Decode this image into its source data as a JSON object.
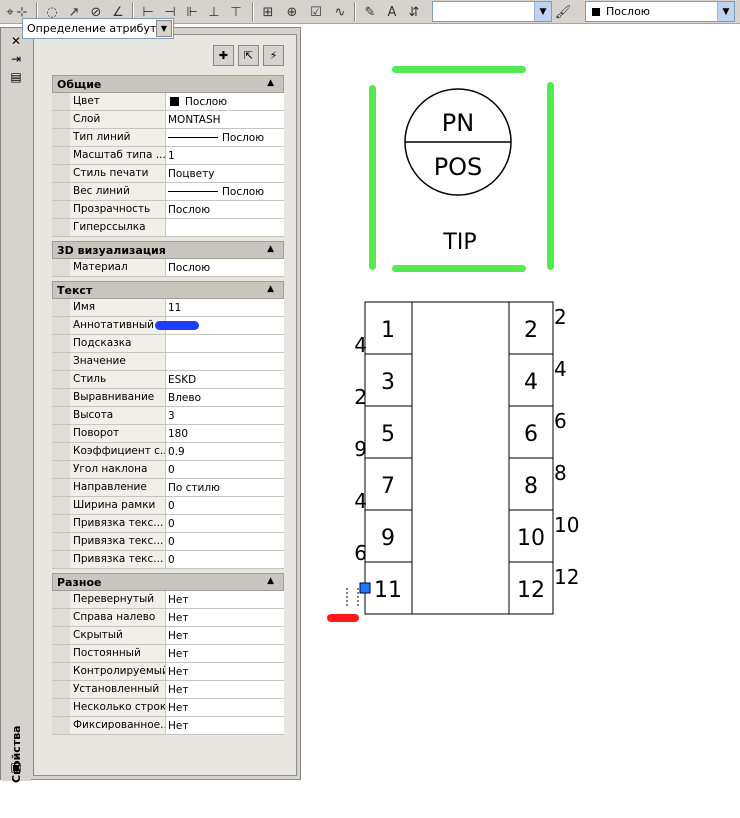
{
  "toolbar": {
    "icons": [
      "ucs-icon",
      "arc-icon",
      "circle-dim-icon",
      "angle-icon",
      "tolerance-icon",
      "baseline-icon",
      "continue-icon",
      "center-mark-icon",
      "block-icon",
      "point-icon",
      "check-icon",
      "wave-icon",
      "pencil-icon",
      "text-edit-icon",
      "attribute-icon"
    ],
    "text_style_combo": "",
    "layer_combo_value": "Послою",
    "colors": {
      "layer_swatch": "#000000"
    }
  },
  "palette": {
    "title": "Свойства",
    "object_selector": "Определение атрибута",
    "sections": [
      {
        "name": "Общие",
        "rows": [
          {
            "label": "Цвет",
            "value": "Послою"
          },
          {
            "label": "Слой",
            "value": "MONTASH"
          },
          {
            "label": "Тип линий",
            "value": "Послою"
          },
          {
            "label": "Масштаб типа ...",
            "value": "1"
          },
          {
            "label": "Стиль печати",
            "value": "Поцвету"
          },
          {
            "label": "Вес линий",
            "value": "Послою"
          },
          {
            "label": "Прозрачность",
            "value": "Послою"
          },
          {
            "label": "Гиперссылка",
            "value": ""
          }
        ]
      },
      {
        "name": "3D визуализация",
        "rows": [
          {
            "label": "Материал",
            "value": "Послою"
          }
        ]
      },
      {
        "name": "Текст",
        "rows": [
          {
            "label": "Имя",
            "value": "11"
          },
          {
            "label": "Аннотативный",
            "value": ""
          },
          {
            "label": "Подсказка",
            "value": ""
          },
          {
            "label": "Значение",
            "value": ""
          },
          {
            "label": "Стиль",
            "value": "ESKD"
          },
          {
            "label": "Выравнивание",
            "value": "Влево"
          },
          {
            "label": "Высота",
            "value": "3"
          },
          {
            "label": "Поворот",
            "value": "180"
          },
          {
            "label": "Коэффициент с...",
            "value": "0.9"
          },
          {
            "label": "Угол наклона",
            "value": "0"
          },
          {
            "label": "Направление",
            "value": "По стилю"
          },
          {
            "label": "Ширина рамки",
            "value": "0"
          },
          {
            "label": "Привязка текс...",
            "value": "0"
          },
          {
            "label": "Привязка текс...",
            "value": "0"
          },
          {
            "label": "Привязка текс...",
            "value": "0"
          }
        ]
      },
      {
        "name": "Разное",
        "rows": [
          {
            "label": "Перевернутый",
            "value": "Нет"
          },
          {
            "label": "Справа налево",
            "value": "Нет"
          },
          {
            "label": "Скрытый",
            "value": "Нет"
          },
          {
            "label": "Постоянный",
            "value": "Нет"
          },
          {
            "label": "Контролируемый",
            "value": "Нет"
          },
          {
            "label": "Установленный",
            "value": "Нет"
          },
          {
            "label": "Несколько строк",
            "value": "Нет"
          },
          {
            "label": "Фиксированное...",
            "value": "Нет"
          }
        ]
      }
    ]
  },
  "drawing": {
    "symbol_top": "PN",
    "symbol_bottom": "POS",
    "symbol_label": "TIP",
    "pins_left": [
      "1",
      "3",
      "5",
      "7",
      "9",
      "11"
    ],
    "pins_right": [
      "2",
      "4",
      "6",
      "8",
      "10",
      "12"
    ],
    "outside_right": [
      "2",
      "4",
      "6",
      "8",
      "10",
      "12"
    ],
    "outside_left": [
      "4",
      "2",
      "9",
      "4",
      "6",
      ""
    ],
    "colors": {
      "frame": "#55e855",
      "marker": "#ff1a1a",
      "grip": "#1e78ff",
      "annotation_mark": "#1e3cff"
    }
  }
}
